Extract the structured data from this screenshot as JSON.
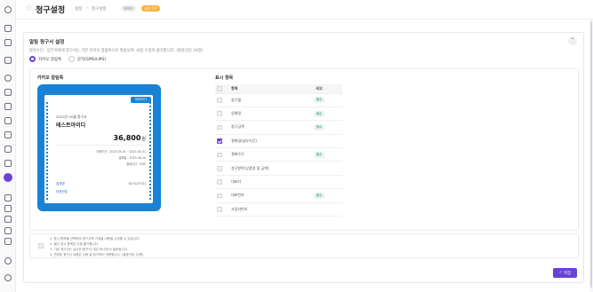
{
  "header": {
    "title": "청구설정",
    "breadcrumb": [
      "설정",
      "청구설정"
    ],
    "sub_badge": "가이드",
    "tip_badge": "설정 TIP"
  },
  "section": {
    "title": "알림 청구서 설정",
    "description": "발송수단 · 납부자에게 청구서는 기본 카카오 알림톡으로 발송되며, 내용 수정이 불가합니다. (발송건당 24원)",
    "radio_options": [
      {
        "label": "카카오 알림톡",
        "selected": true
      },
      {
        "label": "문자(SMS/LMS)",
        "selected": false
      }
    ]
  },
  "preview": {
    "title": "카카오 알림톡",
    "tag": "미리보기",
    "bill_title": "2023년 05월 청구서",
    "name": "테스트아이디",
    "amount": "36,800",
    "unit": "원",
    "period": "이용기간 : 2023-05-01 ~2023-05-31",
    "due": "결제일 : 2023-06-20",
    "method": "결제수단 : CMS",
    "rows": [
      {
        "key": "업체명",
        "value": "테스트아이디"
      },
      {
        "key": "대표번호",
        "value": ""
      }
    ]
  },
  "table": {
    "title": "표시 항목",
    "headers": [
      "항목",
      "비고"
    ],
    "rows": [
      {
        "label": "청구월",
        "required": "필수",
        "checked": false
      },
      {
        "label": "업체명",
        "required": "필수",
        "checked": false
      },
      {
        "label": "청구금액",
        "required": "필수",
        "checked": false
      },
      {
        "label": "결제일(납부기간)",
        "required": "",
        "checked": true
      },
      {
        "label": "결제수단",
        "required": "필수",
        "checked": false
      },
      {
        "label": "청구항목(상품명 및 금액)",
        "required": "",
        "checked": false
      },
      {
        "label": "대표자",
        "required": "",
        "checked": false
      },
      {
        "label": "대표번호",
        "required": "필수",
        "checked": false
      },
      {
        "label": "사업자번호",
        "required": "",
        "checked": false
      }
    ]
  },
  "notes": [
    "1. 표시 항목을 선택하여 청구서에 기재될 내용을 수정할 수 있습니다.",
    "2. 필수 표시 항목은 수정 불가합니다.",
    "3. 기본 메시지는 실시간(청구서 기본 메시지)이 발송됩니다.",
    "4. 변경된 청구서 내용은 다음 달 청구부터 적용됩니다. (발송건당 33원)"
  ],
  "save_label": "저장",
  "colors": {
    "accent": "#6a42d4",
    "preview_blue": "#1a82d4",
    "required_green": "#2c8a55"
  },
  "icons": {
    "collapse": "chevron-up-icon",
    "save": "check-icon",
    "favorite": "star-icon"
  }
}
